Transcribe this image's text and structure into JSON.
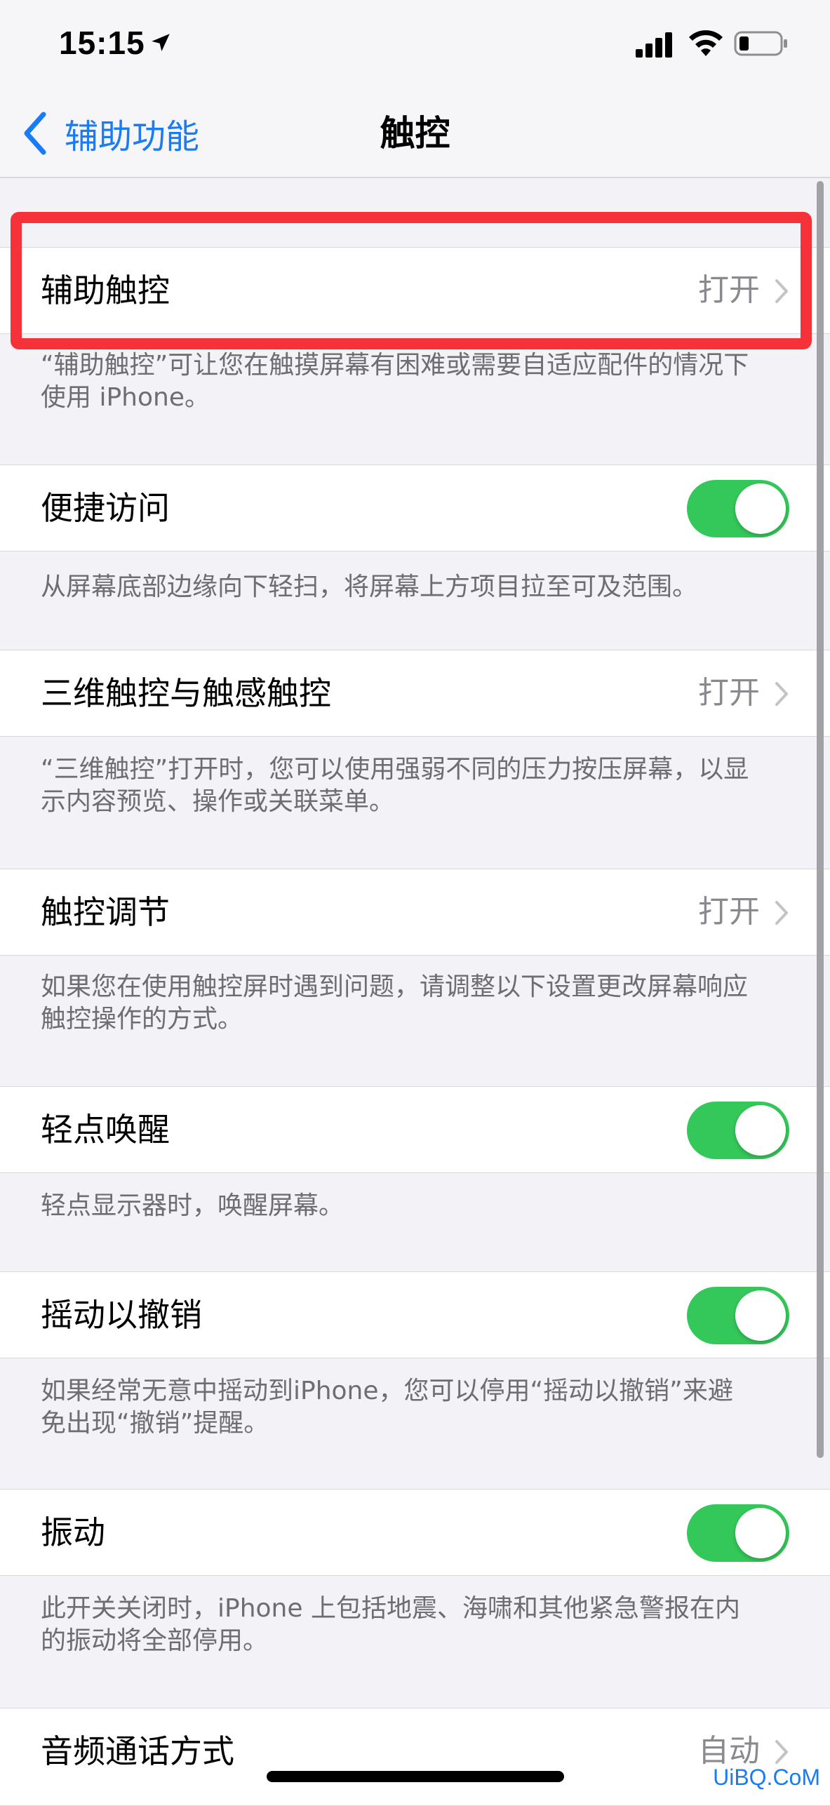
{
  "status_bar": {
    "time": "15:15",
    "icons": [
      "location-arrow-icon",
      "cellular-signal-icon",
      "wifi-icon",
      "battery-low-icon"
    ]
  },
  "nav": {
    "back_label": "辅助功能",
    "title": "触控"
  },
  "colors": {
    "accent": "#1a7cf5",
    "toggle_on": "#34c759",
    "highlight": "#f5313a",
    "background": "#f2f2f7"
  },
  "rows": [
    {
      "label": "辅助触控",
      "value": "打开",
      "type": "disclosure"
    },
    {
      "label": "便捷访问",
      "type": "toggle",
      "on": true
    },
    {
      "label": "三维触控与触感触控",
      "value": "打开",
      "type": "disclosure"
    },
    {
      "label": "触控调节",
      "value": "打开",
      "type": "disclosure"
    },
    {
      "label": "轻点唤醒",
      "type": "toggle",
      "on": true
    },
    {
      "label": "摇动以撤销",
      "type": "toggle",
      "on": true
    },
    {
      "label": "振动",
      "type": "toggle",
      "on": true
    },
    {
      "label": "音频通话方式",
      "value": "自动",
      "type": "disclosure"
    }
  ],
  "footers": [
    {
      "line1": "“辅助触控”可让您在触摸屏幕有困难或需要自适应配件的情况下",
      "line2": "使用 iPhone。"
    },
    {
      "line1": "从屏幕底部边缘向下轻扫，将屏幕上方项目拉至可及范围。",
      "line2": ""
    },
    {
      "line1": "“三维触控”打开时，您可以使用强弱不同的压力按压屏幕，以显",
      "line2": "示内容预览、操作或关联菜单。"
    },
    {
      "line1": "如果您在使用触控屏时遇到问题，请调整以下设置更改屏幕响应",
      "line2": "触控操作的方式。"
    },
    {
      "line1": "轻点显示器时，唤醒屏幕。",
      "line2": ""
    },
    {
      "line1": "如果经常无意中摇动到iPhone，您可以停用“摇动以撤销”来避",
      "line2": "免出现“撤销”提醒。"
    },
    {
      "line1": "此开关关闭时，iPhone 上包括地震、海啸和其他紧急警报在内",
      "line2": "的振动将全部停用。"
    }
  ],
  "watermark": "UiBQ.CoM"
}
